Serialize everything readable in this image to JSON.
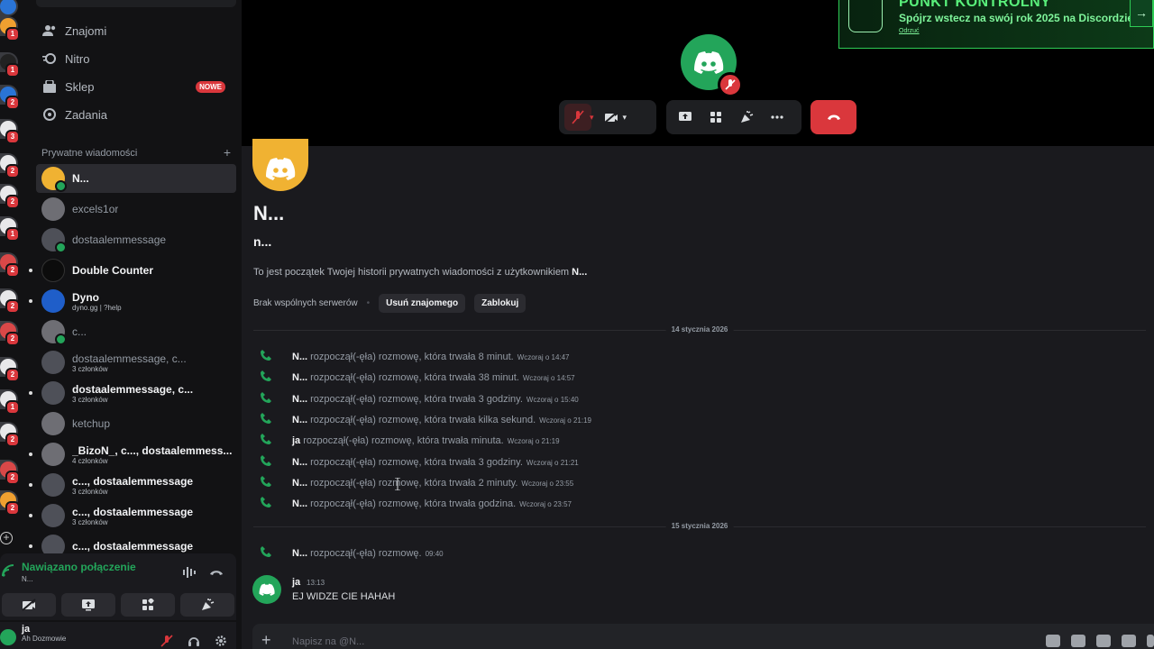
{
  "colors": {
    "accent_green": "#23a55a",
    "danger_red": "#da373c",
    "banner_green": "#59f07b",
    "avatar_orange": "#f0b232"
  },
  "nav": {
    "items": [
      {
        "label": "Znajomi",
        "icon": "friends-icon"
      },
      {
        "label": "Nitro",
        "icon": "nitro-icon"
      },
      {
        "label": "Sklep",
        "icon": "shop-icon",
        "badge": "NOWE"
      },
      {
        "label": "Zadania",
        "icon": "quests-icon"
      }
    ]
  },
  "dm_list": {
    "header": "Prywatne wiadomości",
    "add_label": "+",
    "items": [
      {
        "name": "N...",
        "sub": "",
        "bold": true,
        "active": true
      },
      {
        "name": "excels1or",
        "sub": "",
        "bold": false
      },
      {
        "name": "dostaalemmessage",
        "sub": "",
        "bold": false
      },
      {
        "name": "Double Counter",
        "sub": "",
        "bold": true
      },
      {
        "name": "Dyno",
        "sub": "dyno.gg | ?help",
        "bold": true
      },
      {
        "name": "c...",
        "sub": "",
        "bold": false
      },
      {
        "name": "dostaalemmessage, c...",
        "sub": "3 członków",
        "bold": false
      },
      {
        "name": "dostaalemmessage, c...",
        "sub": "3 członków",
        "bold": true
      },
      {
        "name": "ketchup",
        "sub": "",
        "bold": false
      },
      {
        "name": "_BizoN_, c..., dostaalemmess...",
        "sub": "4 członków",
        "bold": true
      },
      {
        "name": "c..., dostaalemmessage",
        "sub": "3 członków",
        "bold": true
      },
      {
        "name": "c..., dostaalemmessage",
        "sub": "3 członków",
        "bold": true
      },
      {
        "name": "c..., dostaalemmessage",
        "sub": "",
        "bold": true
      }
    ]
  },
  "rail": {
    "badges": [
      "1",
      "1",
      "2",
      "3",
      "2",
      "2",
      "1",
      "2",
      "2",
      "2",
      "2",
      "1",
      "2",
      "2",
      "2"
    ]
  },
  "voice": {
    "status": "Nawiązano połączenie",
    "channel": "N..."
  },
  "user": {
    "name": "ja",
    "status": "Ah Dozmowie"
  },
  "banner": {
    "title": "PUNKT KONTROLNY",
    "text": "Spójrz wstecz na swój rok 2025 na Discordzie",
    "dismiss": "Odrzuć",
    "arrow": "→"
  },
  "hero": {
    "name": "N...",
    "username": "n...",
    "intro_prefix": "To jest początek Twojej historii prywatnych wiadomości z użytkownikiem ",
    "intro_name": "N...",
    "no_servers": "Brak wspólnych serwerów",
    "dot": "•",
    "remove_friend": "Usuń znajomego",
    "block": "Zablokuj"
  },
  "dates": {
    "first": "14 stycznia 2026",
    "second": "15 stycznia 2026"
  },
  "calls": [
    {
      "who": "N...",
      "text": "rozpoczął(-ęła) rozmowę, która trwała 8 minut.",
      "time": "Wczoraj o 14:47"
    },
    {
      "who": "N...",
      "text": "rozpoczął(-ęła) rozmowę, która trwała 38 minut.",
      "time": "Wczoraj o 14:57"
    },
    {
      "who": "N...",
      "text": "rozpoczął(-ęła) rozmowę, która trwała 3 godziny.",
      "time": "Wczoraj o 15:40"
    },
    {
      "who": "N...",
      "text": "rozpoczął(-ęła) rozmowę, która trwała kilka sekund.",
      "time": "Wczoraj o 21:19"
    },
    {
      "who": "ja",
      "text": "rozpoczął(-ęła) rozmowę, która trwała minuta.",
      "time": "Wczoraj o 21:19"
    },
    {
      "who": "N...",
      "text": "rozpoczął(-ęła) rozmowę, która trwała 3 godziny.",
      "time": "Wczoraj o 21:21"
    },
    {
      "who": "N...",
      "text": "rozpoczął(-ęła) rozmowę, która trwała 2 minuty.",
      "time": "Wczoraj o 23:55"
    },
    {
      "who": "N...",
      "text": "rozpoczął(-ęła) rozmowę, która trwała godzina.",
      "time": "Wczoraj o 23:57"
    }
  ],
  "last_call": {
    "who": "N...",
    "text": "rozpoczął(-ęła) rozmowę.",
    "time": "09:40"
  },
  "message": {
    "author": "ja",
    "time": "13:13",
    "text": "EJ WIDZE CIE HAHAH"
  },
  "composer": {
    "placeholder": "Napisz na @N..."
  }
}
